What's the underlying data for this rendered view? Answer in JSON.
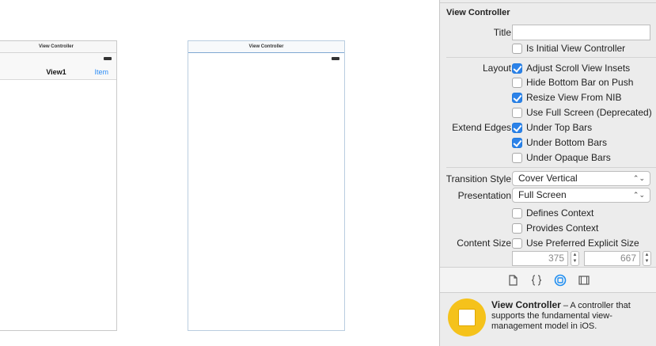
{
  "canvas": {
    "scene1": {
      "dock_title": "View Controller",
      "nav_title": "View1",
      "nav_item": "Item"
    },
    "scene2": {
      "dock_title": "View Controller"
    }
  },
  "inspector": {
    "header": "View Controller",
    "title_label": "Title",
    "title_value": "",
    "initial_vc": {
      "label": "Is Initial View Controller",
      "checked": false
    },
    "layout_label": "Layout",
    "layout": [
      {
        "label": "Adjust Scroll View Insets",
        "checked": true
      },
      {
        "label": "Hide Bottom Bar on Push",
        "checked": false
      },
      {
        "label": "Resize View From NIB",
        "checked": true
      },
      {
        "label": "Use Full Screen (Deprecated)",
        "checked": false
      }
    ],
    "extend_label": "Extend Edges",
    "extend": [
      {
        "label": "Under Top Bars",
        "checked": true
      },
      {
        "label": "Under Bottom Bars",
        "checked": true
      },
      {
        "label": "Under Opaque Bars",
        "checked": false
      }
    ],
    "transition_label": "Transition Style",
    "transition_value": "Cover Vertical",
    "presentation_label": "Presentation",
    "presentation_value": "Full Screen",
    "context": [
      {
        "label": "Defines Context",
        "checked": false
      },
      {
        "label": "Provides Context",
        "checked": false
      }
    ],
    "content_size_label": "Content Size",
    "content_size": {
      "label": "Use Preferred Explicit Size",
      "checked": false
    },
    "width_value": "375",
    "height_value": "667",
    "popup_arrows": "⌃⌄",
    "stepper_glyphs": {
      "up": "▲",
      "down": "▼"
    },
    "tabs": [
      "file-icon",
      "braces-icon",
      "object-library-icon",
      "media-library-icon"
    ],
    "library": {
      "name": "View Controller",
      "description": " – A controller that supports the fundamental view-management model in iOS."
    },
    "accent_color": "#2c82e8",
    "library_icon_color": "#f5c21b"
  }
}
